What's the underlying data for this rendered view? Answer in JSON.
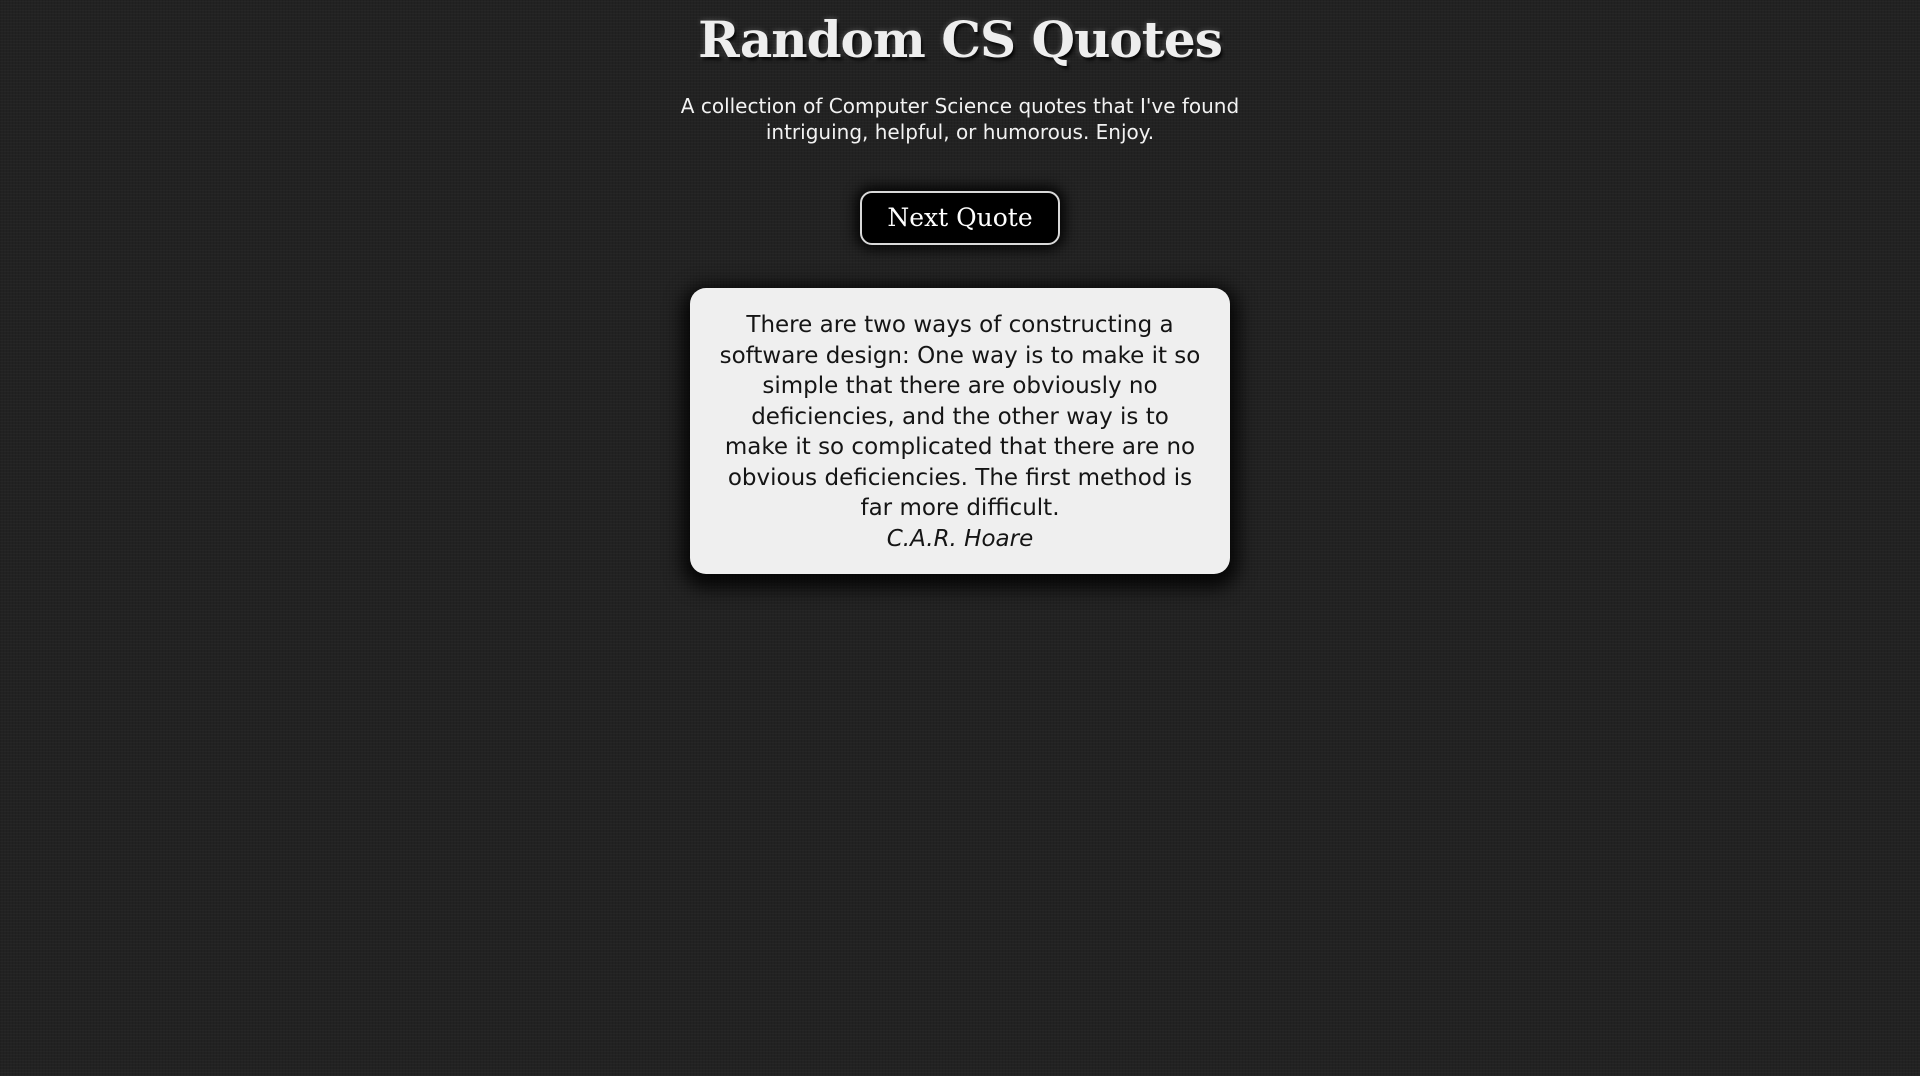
{
  "header": {
    "title": "Random CS Quotes",
    "subtitle": "A collection of Computer Science quotes that I've found intriguing, helpful, or humorous. Enjoy."
  },
  "controls": {
    "next_label": "Next Quote"
  },
  "quote": {
    "text": "There are two ways of constructing a software design: One way is to make it so simple that there are obviously no deficiencies, and the other way is to make it so complicated that there are no obvious deficiencies. The first method is far more difficult.",
    "author": "C.A.R. Hoare"
  },
  "colors": {
    "background": "#222222",
    "card_background": "#efefef",
    "button_background": "#000000",
    "title_text": "#eeeeee"
  }
}
